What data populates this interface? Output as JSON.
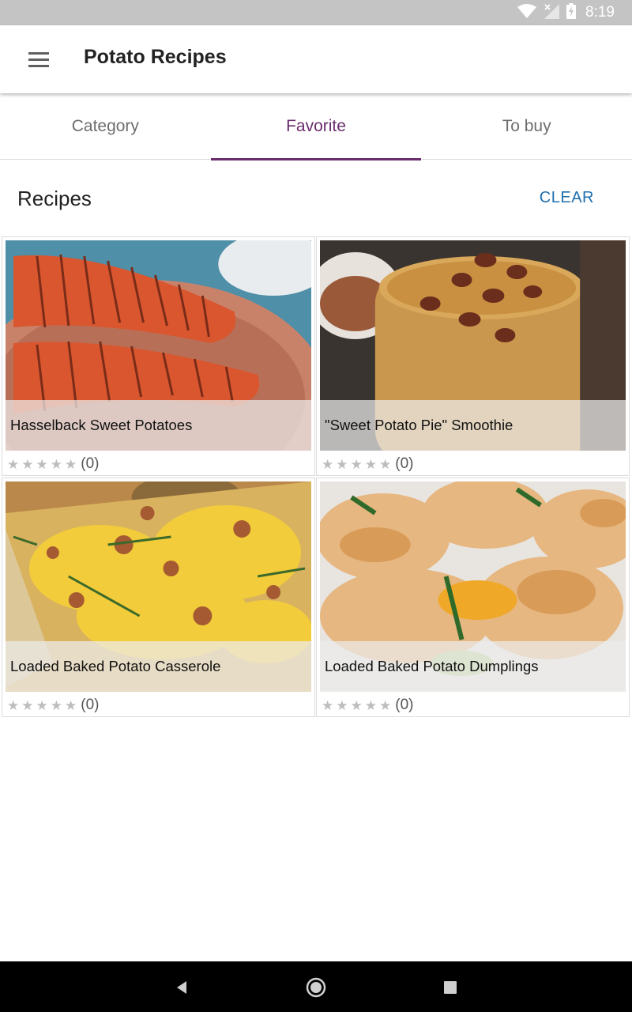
{
  "status_bar": {
    "time": "8:19",
    "icons": [
      "wifi-icon",
      "no-signal-icon",
      "battery-charging-icon"
    ]
  },
  "app_bar": {
    "title": "Potato Recipes",
    "menu_icon": "menu-icon"
  },
  "tabs": [
    {
      "label": "Category",
      "active": false
    },
    {
      "label": "Favorite",
      "active": true
    },
    {
      "label": "To buy",
      "active": false
    }
  ],
  "section": {
    "title": "Recipes",
    "clear_label": "CLEAR"
  },
  "recipes": [
    {
      "title": "Hasselback Sweet Potatoes",
      "rating_count": "(0)",
      "stars": 0
    },
    {
      "title": "\"Sweet Potato Pie\" Smoothie",
      "rating_count": "(0)",
      "stars": 0
    },
    {
      "title": "Loaded Baked Potato Casserole",
      "rating_count": "(0)",
      "stars": 0
    },
    {
      "title": "Loaded Baked Potato Dumplings",
      "rating_count": "(0)",
      "stars": 0
    }
  ],
  "colors": {
    "accent": "#6a2c6c",
    "clear_button": "#1f6fae",
    "status_bar": "#c4c4c4",
    "nav_bar": "#000000"
  },
  "nav_bar": {
    "buttons": [
      "back-icon",
      "home-icon",
      "recents-icon"
    ]
  }
}
